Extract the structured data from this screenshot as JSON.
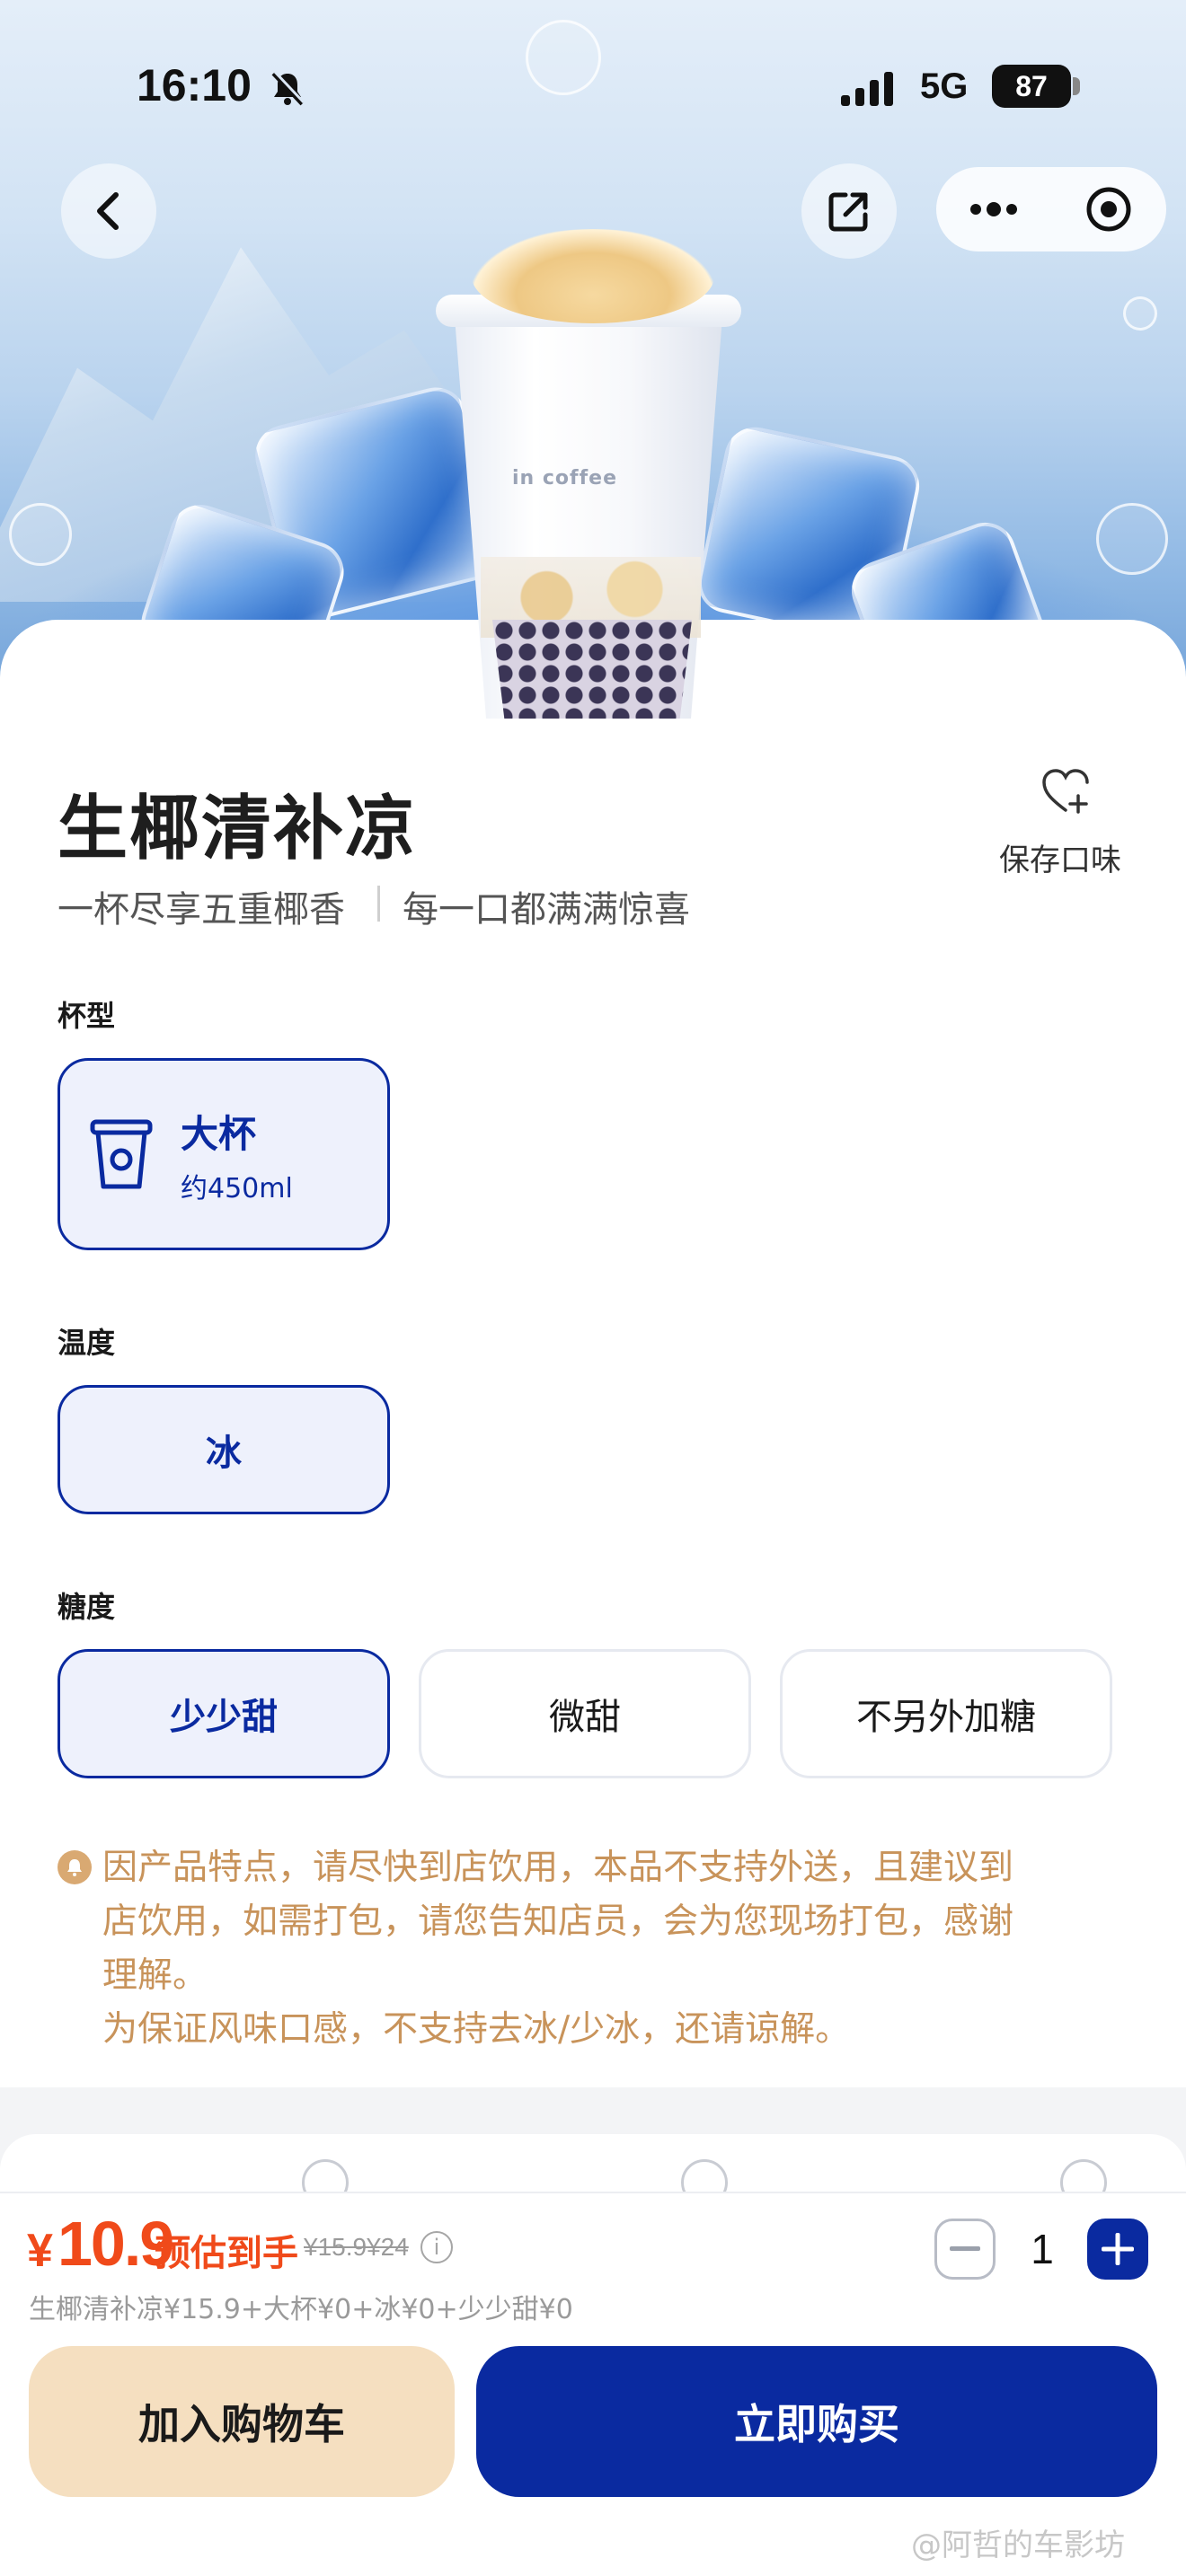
{
  "status_bar": {
    "time": "16:10",
    "network": "5G",
    "battery": "87"
  },
  "product": {
    "name": "生椰清补凉",
    "tagline_left": "一杯尽享五重椰香",
    "tagline_right": "每一口都满满惊喜",
    "cup_brand_text": "in coffee",
    "save_flavor_label": "保存口味"
  },
  "cup_size": {
    "label": "杯型",
    "options": [
      {
        "name": "大杯",
        "volume": "约450ml",
        "selected": true
      }
    ]
  },
  "temperature": {
    "label": "温度",
    "options": [
      {
        "name": "冰",
        "selected": true
      }
    ]
  },
  "sweetness": {
    "label": "糖度",
    "options": [
      {
        "name": "少少甜",
        "selected": true
      },
      {
        "name": "微甜",
        "selected": false
      },
      {
        "name": "不另外加糖",
        "selected": false
      }
    ]
  },
  "notice": {
    "lines": [
      "因产品特点，请尽快到店饮用，本品不支持外送，且建议到",
      "店饮用，如需打包，请您告知店员，会为您现场打包，感谢",
      "理解。",
      "为保证风味口感，不支持去冰/少冰，还请谅解。"
    ]
  },
  "purchase": {
    "currency": "¥",
    "price": "10.9",
    "estimate_label": "预估到手",
    "original_prices": "¥15.9¥24",
    "breakdown": "生椰清补凉¥15.9+大杯¥0+冰¥0+少少甜¥0",
    "quantity": "1",
    "add_to_cart": "加入购物车",
    "buy_now": "立即购买"
  },
  "watermark": "@阿哲的车影坊",
  "colors": {
    "brand_blue": "#0a2aa0",
    "price_red": "#f04a1a",
    "notice_tan": "#c8935a",
    "cart_button_bg": "#f5dfc0"
  },
  "icons": [
    "back-icon",
    "share-icon",
    "more-icon",
    "target-icon",
    "heart-plus-icon",
    "cup-icon",
    "bell-icon",
    "info-icon",
    "minus-icon",
    "plus-icon"
  ]
}
